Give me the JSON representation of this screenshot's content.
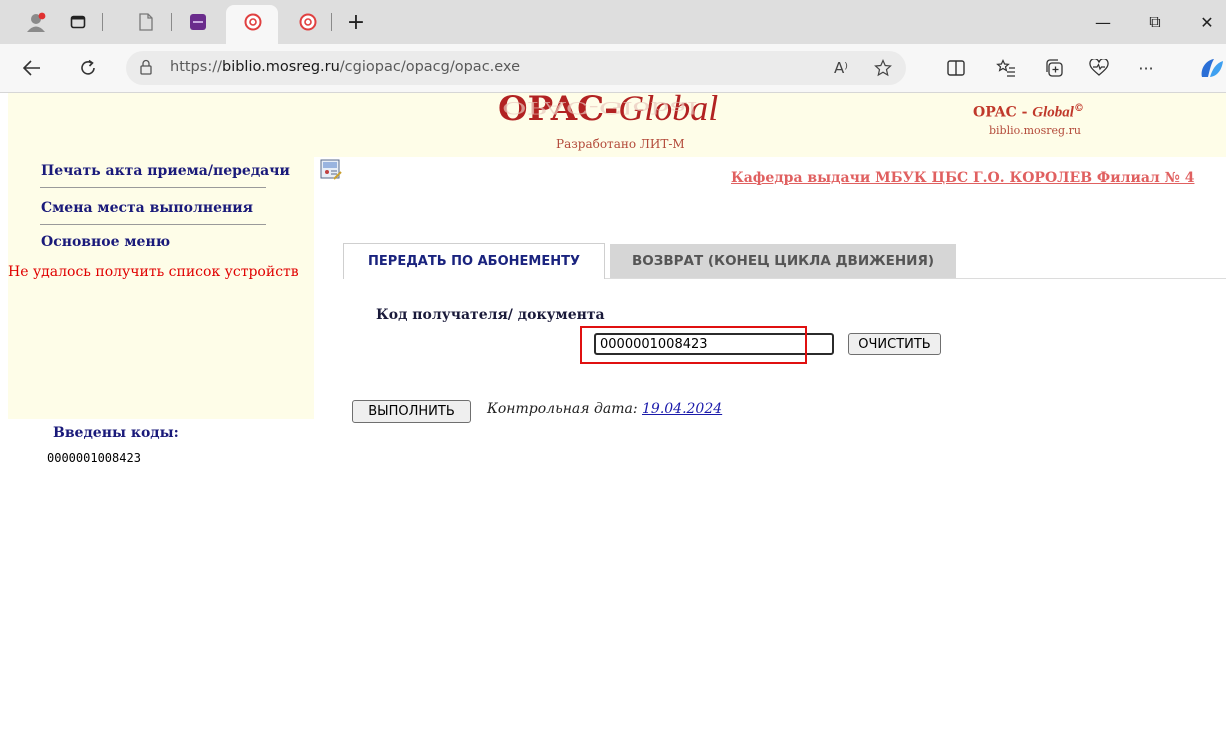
{
  "browser": {
    "url_prefix": "https://",
    "url_domain": "biblio.mosreg.ru",
    "url_path": "/cgiopac/opacg/opac.exe",
    "tab_plus": "+",
    "window": {
      "minimize": "—",
      "restore": "⧉",
      "close": "✕"
    },
    "read_aloud": "A⁾",
    "more": "···"
  },
  "header": {
    "logo_prefix": "OPAC-",
    "logo_suffix": "Global",
    "logo_reflection": "OPAC-Global",
    "logo_sub": "Разработано ЛИТ-М",
    "brand_prefix": "OPAC - ",
    "brand_suffix": "Global",
    "brand_mark": "©",
    "brand_site": "biblio.mosreg.ru"
  },
  "sidebar": {
    "items": [
      {
        "label": "Печать акта приема/передачи"
      },
      {
        "label": "Смена места выполнения"
      },
      {
        "label": "Основное меню"
      }
    ],
    "error": "Не удалось получить список устройств"
  },
  "main": {
    "dept_link": "Кафедра выдачи МБУК ЦБС Г.О. КОРОЛЕВ Филиал № 4",
    "tabs": [
      {
        "label": "ПЕРЕДАТЬ ПО АБОНЕМЕНТУ",
        "active": true
      },
      {
        "label": "ВОЗВРАТ (КОНЕЦ ЦИКЛА ДВИЖЕНИЯ)",
        "active": false
      }
    ],
    "code_label": "Код получателя/ документа",
    "code_value": "0000001008423",
    "clear_button": "ОЧИСТИТЬ",
    "execute_button": "ВЫПОЛНИТЬ",
    "control_date_label": "Контрольная дата:",
    "control_date": "19.04.2024"
  },
  "entered": {
    "title": "Введены коды:",
    "codes": [
      "0000001008423"
    ]
  },
  "colors": {
    "page_bg": "#fefde8",
    "accent_red": "#b22222",
    "nav_blue": "#1a1a7a",
    "highlight_red": "#e01010"
  }
}
